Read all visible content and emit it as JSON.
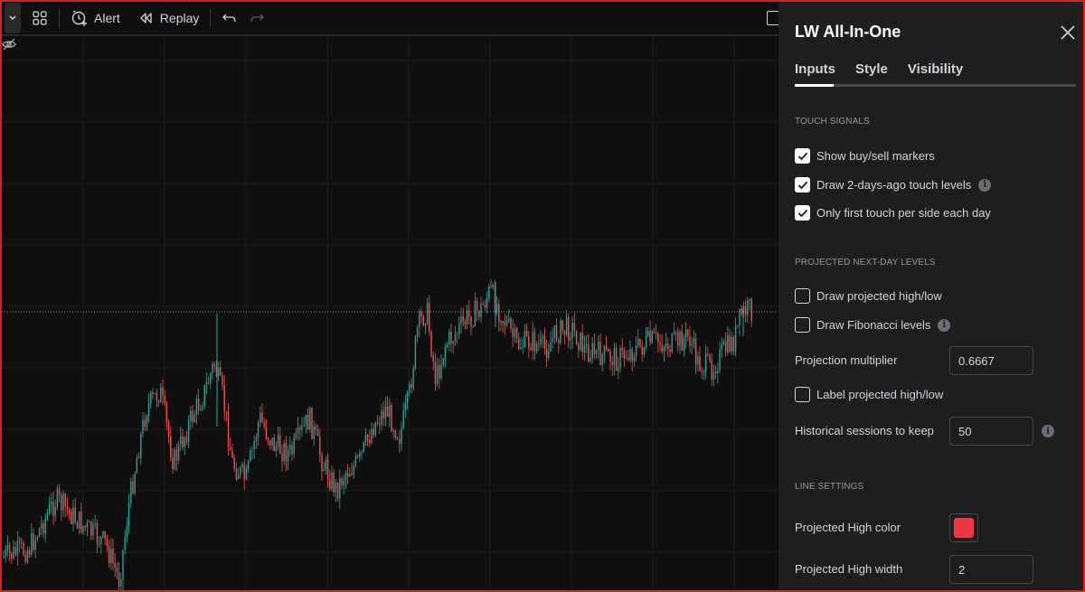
{
  "toolbar": {
    "alert_label": "Alert",
    "replay_label": "Replay"
  },
  "panel": {
    "title": "LW All-In-One",
    "tabs": [
      {
        "label": "Inputs",
        "active": true
      },
      {
        "label": "Style",
        "active": false
      },
      {
        "label": "Visibility",
        "active": false
      }
    ],
    "sections": {
      "touch_signals": {
        "title": "TOUCH SIGNALS",
        "items": [
          {
            "label": "Show buy/sell markers",
            "checked": true
          },
          {
            "label": "Draw 2-days-ago touch levels",
            "checked": true,
            "info": true
          },
          {
            "label": "Only first touch per side each day",
            "checked": true
          }
        ]
      },
      "projected": {
        "title": "PROJECTED NEXT-DAY LEVELS",
        "draw_high_low": {
          "label": "Draw projected high/low",
          "checked": false
        },
        "draw_fib": {
          "label": "Draw Fibonacci levels",
          "checked": false,
          "info": true
        },
        "multiplier": {
          "label": "Projection multiplier",
          "value": "0.6667"
        },
        "label_high_low": {
          "label": "Label projected high/low",
          "checked": false
        },
        "sessions": {
          "label": "Historical sessions to keep",
          "value": "50",
          "info": true
        }
      },
      "line_settings": {
        "title": "LINE SETTINGS",
        "high_color": {
          "label": "Projected High color",
          "color": "#f23645"
        },
        "high_width": {
          "label": "Projected High width",
          "value": "2"
        }
      }
    }
  },
  "colors": {
    "up": "#26a69a",
    "down": "#ef5350",
    "accent_frame": "#e21b1b"
  }
}
